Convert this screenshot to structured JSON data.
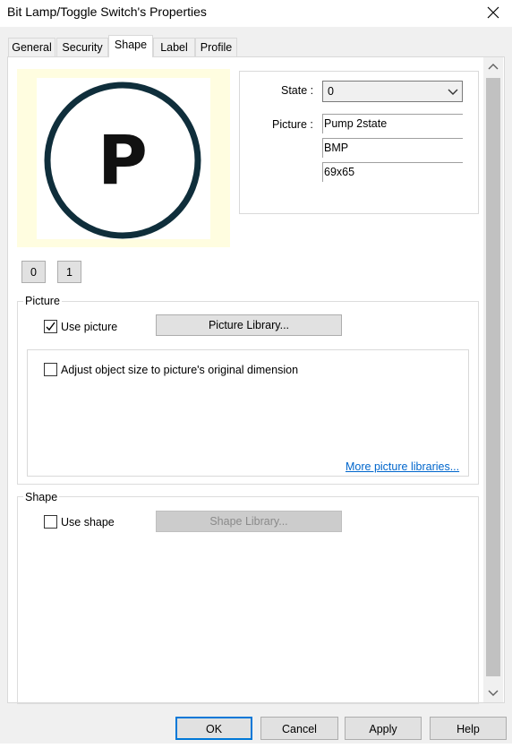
{
  "window": {
    "title": "Bit Lamp/Toggle Switch's Properties"
  },
  "tabs": [
    {
      "label": "General"
    },
    {
      "label": "Security"
    },
    {
      "label": "Shape",
      "active": true
    },
    {
      "label": "Label"
    },
    {
      "label": "Profile"
    }
  ],
  "preview": {
    "glyph": "P"
  },
  "properties": {
    "state_label": "State :",
    "state_value": "0",
    "picture_label": "Picture :",
    "picture_name": "Pump 2state",
    "picture_format": "BMP",
    "picture_size": "69x65"
  },
  "state_buttons": [
    "0",
    "1"
  ],
  "picture_group": {
    "title": "Picture",
    "use_picture_label": "Use picture",
    "use_picture_checked": true,
    "library_button": "Picture Library...",
    "adjust_label": "Adjust object size to picture's original dimension",
    "adjust_checked": false,
    "more_link": "More picture libraries..."
  },
  "shape_group": {
    "title": "Shape",
    "use_shape_label": "Use shape",
    "use_shape_checked": false,
    "library_button": "Shape Library..."
  },
  "buttons": {
    "ok": "OK",
    "cancel": "Cancel",
    "apply": "Apply",
    "help": "Help"
  },
  "colors": {
    "accent": "#0078d7",
    "link": "#0066cc",
    "preview_bg": "#fffde0",
    "symbol": "#0f2e3b"
  }
}
